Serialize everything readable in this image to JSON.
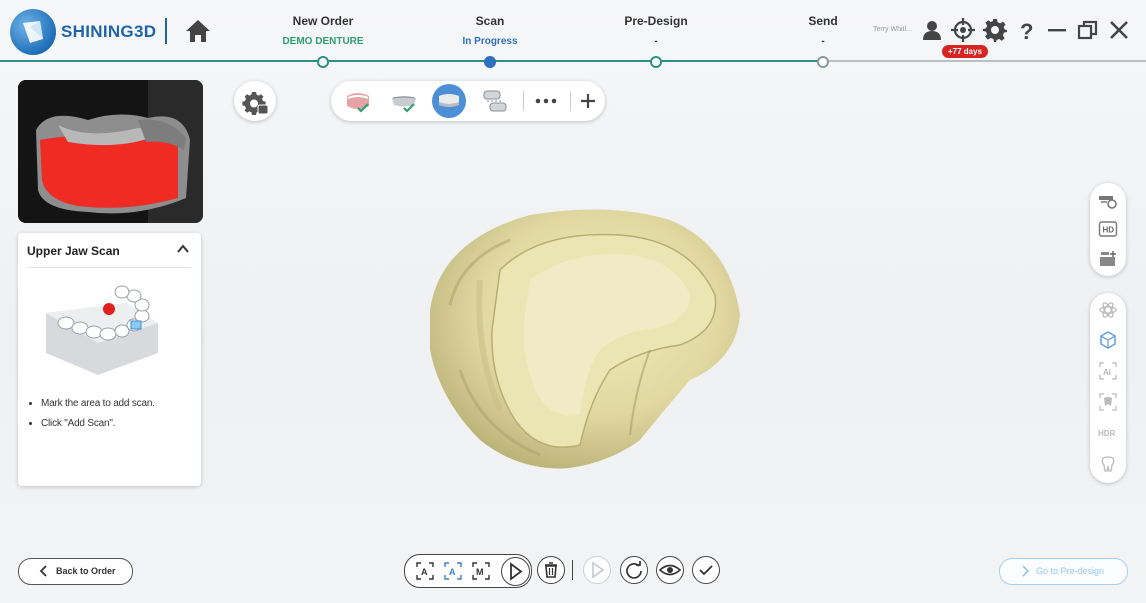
{
  "header": {
    "brand": "SHINING3D",
    "user_name": "Terry Whitl...",
    "days_badge": "+77 days",
    "steps": [
      {
        "title": "New Order",
        "subtitle": "DEMO DENTURE",
        "subtitle_color": "#2f9e6f"
      },
      {
        "title": "Scan",
        "subtitle": "In Progress",
        "subtitle_color": "#2f6fbf"
      },
      {
        "title": "Pre-Design",
        "subtitle": "-",
        "subtitle_color": "#333333"
      },
      {
        "title": "Send",
        "subtitle": "-",
        "subtitle_color": "#333333"
      }
    ]
  },
  "scan_panel": {
    "title": "Upper Jaw Scan",
    "instructions": [
      "Mark the area to add scan.",
      "Click \"Add Scan\"."
    ]
  },
  "toolbar": {
    "items": [
      "upper-jaw-icon",
      "lower-jaw-icon",
      "denture-icon",
      "occlusion-icon",
      "more-icon",
      "add-icon"
    ],
    "selected": "denture-icon"
  },
  "right_tools": {
    "group1": [
      "scan-settings-icon",
      "hd-icon",
      "texture-icon"
    ],
    "group2": [
      "atom-icon",
      "cube-icon",
      "ai-icon",
      "trim-icon",
      "hdr-icon",
      "tooth-icon"
    ],
    "hd_label": "HD",
    "ai_label": "AI",
    "hdr_label": "HDR"
  },
  "bottom": {
    "back_label": "Back to Order",
    "next_label": "Go to Pre-design",
    "scan_modes": [
      "A",
      "A",
      "M"
    ]
  },
  "colors": {
    "accent": "#2f8f88",
    "brand_blue": "#1f64a8",
    "selected_blue": "#4d8fd6",
    "badge_red": "#d92424",
    "model_color": "#e3dca6"
  }
}
